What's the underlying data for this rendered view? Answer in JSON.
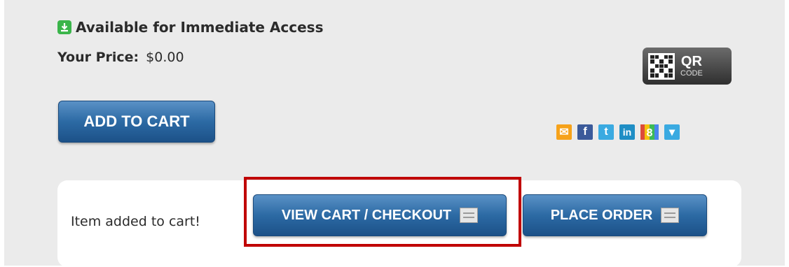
{
  "availability": {
    "text": "Available for Immediate Access",
    "icon": "download-icon",
    "icon_color": "#3ab54a"
  },
  "price": {
    "label": "Your Price:",
    "value": "$0.00"
  },
  "qr_badge": {
    "title": "QR",
    "subtitle": "CODE"
  },
  "add_to_cart": {
    "label": "ADD TO CART"
  },
  "share_icons": [
    {
      "name": "email-icon",
      "glyph": "✉"
    },
    {
      "name": "facebook-icon",
      "glyph": "f"
    },
    {
      "name": "twitter-icon",
      "glyph": "t"
    },
    {
      "name": "linkedin-icon",
      "glyph": "in"
    },
    {
      "name": "google-plus-icon",
      "glyph": "8"
    },
    {
      "name": "more-share-icon",
      "glyph": "▾"
    }
  ],
  "cart_notice": {
    "message": "Item added to cart!",
    "view_cart_label": "VIEW CART / CHECKOUT",
    "place_order_label": "PLACE ORDER"
  },
  "colors": {
    "button_blue": "#2c6aa4",
    "highlight_red": "#c00000",
    "panel_bg": "#ebebeb"
  }
}
